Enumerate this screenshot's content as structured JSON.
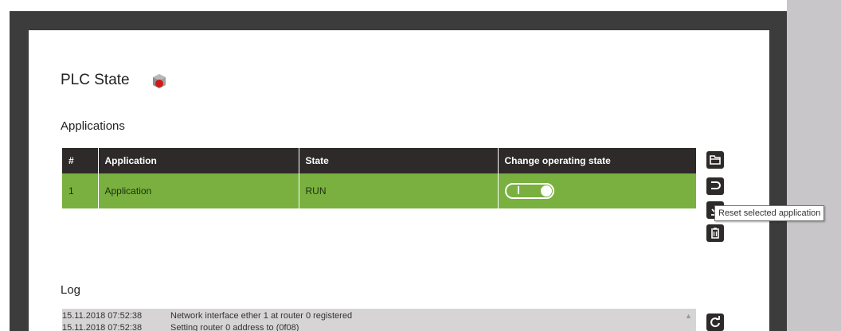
{
  "page": {
    "title": "PLC State",
    "applications_heading": "Applications",
    "log_heading": "Log"
  },
  "table": {
    "columns": [
      "#",
      "Application",
      "State",
      "Change operating state"
    ],
    "rows": [
      {
        "index": "1",
        "application": "Application",
        "state": "RUN",
        "operating_toggle_on": true
      }
    ]
  },
  "actions": {
    "tooltip": "Reset selected application",
    "icons": [
      "folder-icon",
      "return-icon",
      "download-icon",
      "trash-icon",
      "refresh-icon"
    ]
  },
  "log": {
    "lines": [
      {
        "timestamp": "15.11.2018 07:52:38",
        "message": "Network interface ether 1 at router 0 registered"
      },
      {
        "timestamp": "15.11.2018 07:52:38",
        "message": "Setting router 0 address to (0f08)"
      }
    ]
  },
  "colors": {
    "accent_green": "#79b03f",
    "header_dark": "#2e2a2a",
    "frame_dark": "#3c3c3c",
    "plc_red": "#d01a1a"
  }
}
